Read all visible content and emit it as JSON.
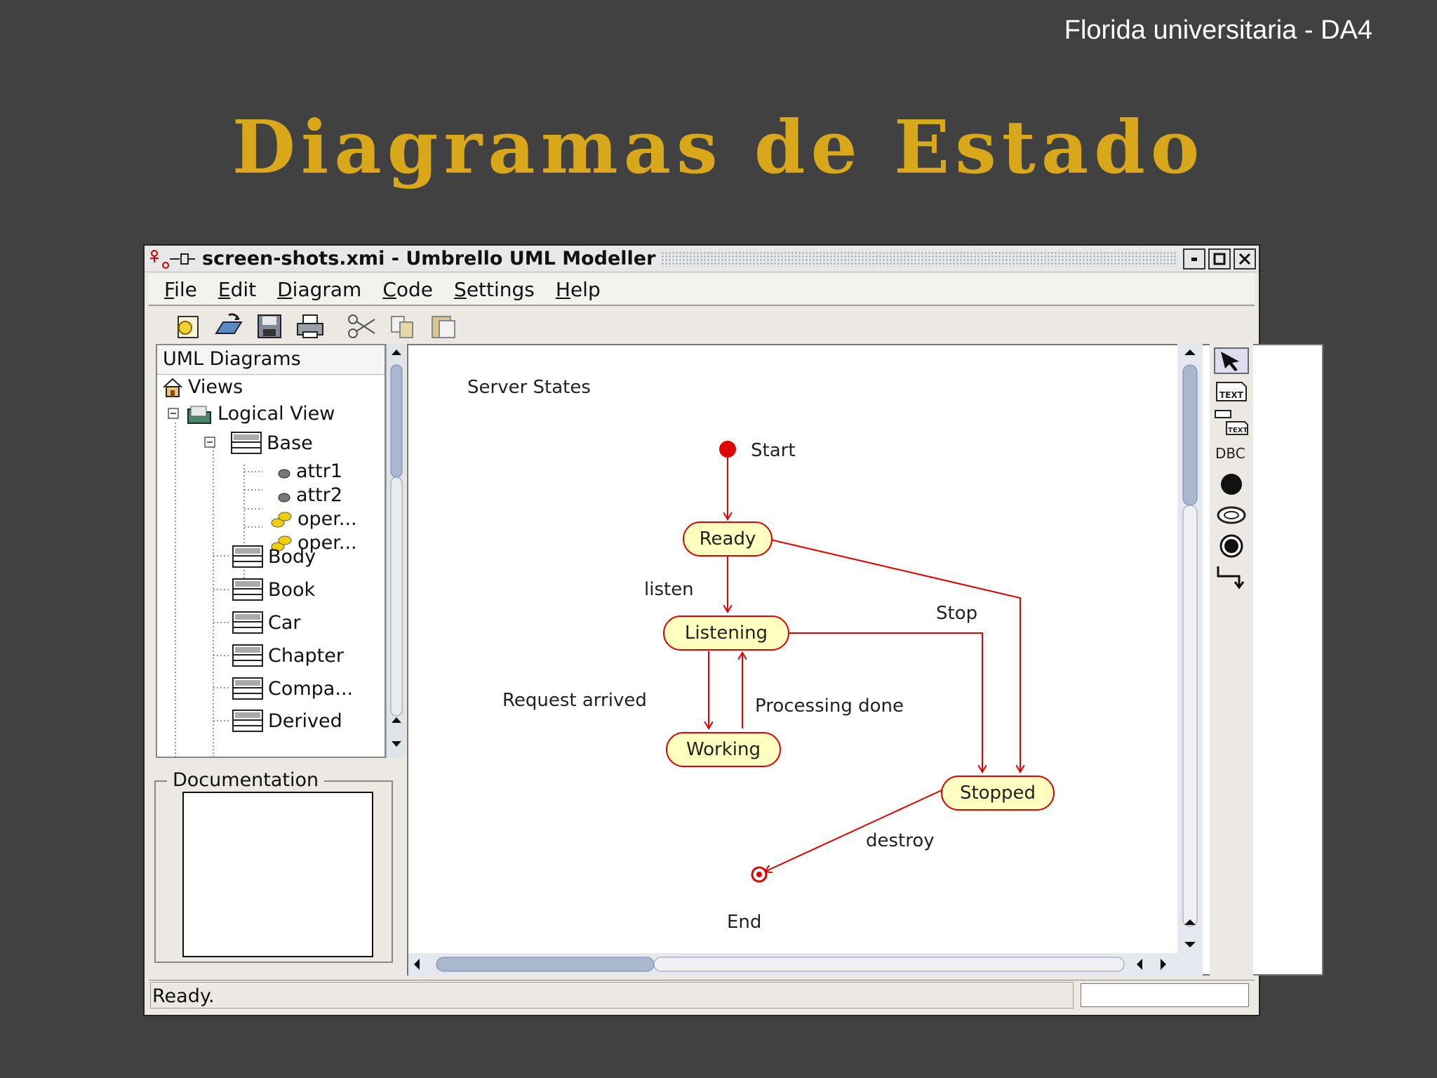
{
  "slide": {
    "header": "Florida universitaria - DA4",
    "title": "Diagramas de Estado"
  },
  "window": {
    "title": "screen-shots.xmi - Umbrello UML Modeller",
    "menus": [
      "File",
      "Edit",
      "Diagram",
      "Code",
      "Settings",
      "Help"
    ],
    "toolbar_icons": [
      "new-document-icon",
      "open-icon",
      "save-icon",
      "print-icon",
      "cut-icon",
      "copy-icon",
      "paste-icon"
    ]
  },
  "tree": {
    "header": "UML Diagrams",
    "root": "Views",
    "logical_view": "Logical View",
    "base": "Base",
    "base_children": [
      "attr1",
      "attr2",
      "oper...",
      "oper..."
    ],
    "classes": [
      "Body",
      "Book",
      "Car",
      "Chapter",
      "Compa...",
      "Derived"
    ]
  },
  "documentation": {
    "label": "Documentation"
  },
  "diagram": {
    "title": "Server States",
    "states": {
      "ready": "Ready",
      "listening": "Listening",
      "working": "Working",
      "stopped": "Stopped"
    },
    "labels": {
      "start": "Start",
      "end": "End",
      "listen": "listen",
      "stop": "Stop",
      "request_arrived": "Request arrived",
      "processing_done": "Processing done",
      "destroy": "destroy"
    }
  },
  "status": {
    "text": "Ready."
  },
  "colors": {
    "title_gold": "#d8a81a",
    "state_fill": "#ffffc0",
    "transition_red": "#e00000"
  }
}
